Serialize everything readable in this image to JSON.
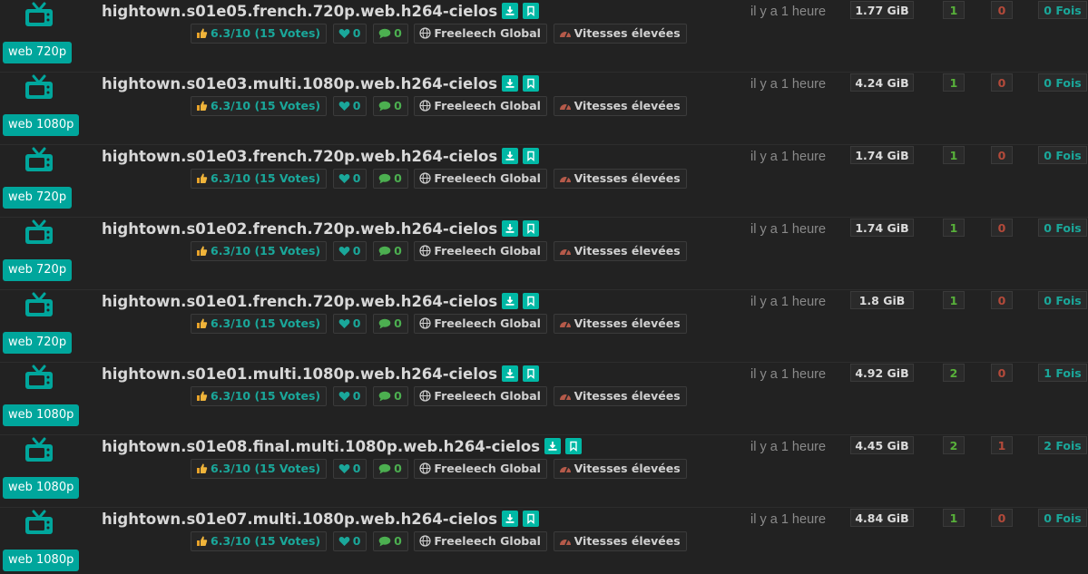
{
  "torrents": [
    {
      "category": "web 720p",
      "name": "hightown.s01e05.french.720p.web.h264-cielos",
      "rating": "6.3/10 (15 Votes)",
      "likes": "0",
      "comments": "0",
      "freeleech": "Freeleech Global",
      "speed": "Vitesses élevées",
      "age": "il y a 1 heure",
      "size": "1.77 GiB",
      "seeders": "1",
      "leechers": "0",
      "completed": "0 Fois"
    },
    {
      "category": "web 1080p",
      "name": "hightown.s01e03.multi.1080p.web.h264-cielos",
      "rating": "6.3/10 (15 Votes)",
      "likes": "0",
      "comments": "0",
      "freeleech": "Freeleech Global",
      "speed": "Vitesses élevées",
      "age": "il y a 1 heure",
      "size": "4.24 GiB",
      "seeders": "1",
      "leechers": "0",
      "completed": "0 Fois"
    },
    {
      "category": "web 720p",
      "name": "hightown.s01e03.french.720p.web.h264-cielos",
      "rating": "6.3/10 (15 Votes)",
      "likes": "0",
      "comments": "0",
      "freeleech": "Freeleech Global",
      "speed": "Vitesses élevées",
      "age": "il y a 1 heure",
      "size": "1.74 GiB",
      "seeders": "1",
      "leechers": "0",
      "completed": "0 Fois"
    },
    {
      "category": "web 720p",
      "name": "hightown.s01e02.french.720p.web.h264-cielos",
      "rating": "6.3/10 (15 Votes)",
      "likes": "0",
      "comments": "0",
      "freeleech": "Freeleech Global",
      "speed": "Vitesses élevées",
      "age": "il y a 1 heure",
      "size": "1.74 GiB",
      "seeders": "1",
      "leechers": "0",
      "completed": "0 Fois"
    },
    {
      "category": "web 720p",
      "name": "hightown.s01e01.french.720p.web.h264-cielos",
      "rating": "6.3/10 (15 Votes)",
      "likes": "0",
      "comments": "0",
      "freeleech": "Freeleech Global",
      "speed": "Vitesses élevées",
      "age": "il y a 1 heure",
      "size": "1.8 GiB",
      "seeders": "1",
      "leechers": "0",
      "completed": "0 Fois"
    },
    {
      "category": "web 1080p",
      "name": "hightown.s01e01.multi.1080p.web.h264-cielos",
      "rating": "6.3/10 (15 Votes)",
      "likes": "0",
      "comments": "0",
      "freeleech": "Freeleech Global",
      "speed": "Vitesses élevées",
      "age": "il y a 1 heure",
      "size": "4.92 GiB",
      "seeders": "2",
      "leechers": "0",
      "completed": "1 Fois"
    },
    {
      "category": "web 1080p",
      "name": "hightown.s01e08.final.multi.1080p.web.h264-cielos",
      "rating": "6.3/10 (15 Votes)",
      "likes": "0",
      "comments": "0",
      "freeleech": "Freeleech Global",
      "speed": "Vitesses élevées",
      "age": "il y a 1 heure",
      "size": "4.45 GiB",
      "seeders": "2",
      "leechers": "1",
      "completed": "2 Fois"
    },
    {
      "category": "web 1080p",
      "name": "hightown.s01e07.multi.1080p.web.h264-cielos",
      "rating": "6.3/10 (15 Votes)",
      "likes": "0",
      "comments": "0",
      "freeleech": "Freeleech Global",
      "speed": "Vitesses élevées",
      "age": "il y a 1 heure",
      "size": "4.84 GiB",
      "seeders": "1",
      "leechers": "0",
      "completed": "0 Fois"
    }
  ],
  "colors": {
    "accent": "#00a69c",
    "seeders": "#58b13a",
    "leechers": "#b44a3a",
    "background": "#222222"
  },
  "icons": {
    "category": "tv-icon",
    "download": "download-icon",
    "bookmark": "bookmark-icon",
    "votes": "thumbs-up-icon",
    "likes": "heart-icon",
    "comments": "comment-icon",
    "freeleech": "globe-icon",
    "speed": "speedometer-icon"
  }
}
